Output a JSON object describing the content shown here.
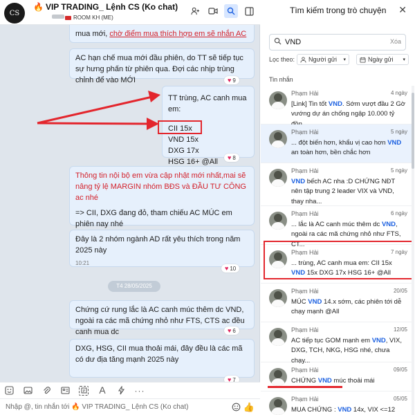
{
  "chat": {
    "avatar_text": "CS",
    "title": "VIP TRADING_ Lệnh CS (Ko chat)",
    "title_icon": "fire-icon",
    "subtitle": "ROOM KH (ME)",
    "header_icons": [
      "add-member-icon",
      "video-call-icon",
      "search-icon",
      "layout-toggle-icon"
    ]
  },
  "messages": {
    "m0_part1": "mua mới, ",
    "m0_part2": "chờ điểm mua thích hợp em sẽ nhắn AC",
    "m1": "AC hạn chế mua mới đầu phiên, do TT sẽ tiếp tục sự hưng phấn từ phiên qua. Đợi các nhịp trùng chỉnh để vào MỚI",
    "m1_react": "9",
    "m2_lines": [
      "TT trùng, AC canh mua em:",
      "CII 15x",
      "VND 15x",
      "DXG 17x",
      "HSG 16+ @All"
    ],
    "m2_react": "8",
    "m3_red": "Thông tin nội bộ em vừa cập nhật mới nhất,mai sẽ nâng tỷ lệ MARGIN nhóm BĐS và ĐẦU TƯ CÔNG ac nhé",
    "m3_black": "=> CII, DXG đang đỏ, tham chiếu AC  MÚC em phiên nay nhé",
    "m4": "Đây là 2 nhóm ngành AD rất yêu thích trong năm 2025 này",
    "m4_time": "10:21",
    "m4_react": "10",
    "date_sep": "T4 28/05/2025",
    "m5": "Chứng cứ rung lắc là AC canh múc thêm dc VND, ngoài ra các mã chứng nhỏ như FTS, CTS ac đều canh mua dc",
    "m5_react": "6",
    "m6": "DXG, HSG, CII mua thoải mái, đây đều là các mã có dư địa tăng mạnh 2025 này",
    "m6_react": "7"
  },
  "composer": {
    "placeholder": "Nhập @, tin nhắn tới 🔥 VIP TRADING_ Lệnh CS (Ko chat)",
    "toolbar_icons": [
      "sticker-icon",
      "image-icon",
      "attachment-icon",
      "contact-card-icon",
      "screenshot-icon",
      "text-format-icon",
      "quick-message-icon",
      "more-icon"
    ]
  },
  "search": {
    "title": "Tìm kiếm trong trò chuyện",
    "query": "VND",
    "clear_label": "Xóa",
    "filter_label": "Lọc theo:",
    "filter_sender": "Người gửi",
    "filter_date": "Ngày gửi",
    "section_label": "Tin nhắn",
    "results": [
      {
        "sender": "Phạm Hải",
        "date": "4 ngày",
        "pre": "[Link] Tin tốt ",
        "kw": "VND",
        "post": ". Sớm vượt đầu 2 Gờ vướng dự án chống ngập 10.000 tỷ đồn..."
      },
      {
        "sender": "Phạm Hải",
        "date": "5 ngày",
        "pre": "... đột biến hơn, khẩu vị cao hơn ",
        "kw": "VND",
        "post": " an toàn hơn, bền chắc hơn"
      },
      {
        "sender": "Phạm Hải",
        "date": "5 ngày",
        "pre": "",
        "kw": "VND",
        "post": " bếch AC nha :D CHỨNG NĐT nên tập trung 2 leader VIX và VND, thay nha..."
      },
      {
        "sender": "Phạm Hải",
        "date": "6 ngày",
        "pre": "... lắc là AC canh múc thêm dc ",
        "kw": "VND",
        "post": ", ngoài ra các mã chứng nhỏ như FTS, CT..."
      },
      {
        "sender": "Phạm Hải",
        "date": "7 ngày",
        "pre": "... trùng, AC canh mua em: CII 15x ",
        "kw": "VND",
        "post": " 15x DXG 17x HSG 16+ @All"
      },
      {
        "sender": "Phạm Hải",
        "date": "20/05",
        "pre": "MÚC ",
        "kw": "VND",
        "post": " 14.x sớm, các phiên tới dễ chạy mạnh @All"
      },
      {
        "sender": "Phạm Hải",
        "date": "12/05",
        "pre": "AC tiếp tục GOM mạnh em ",
        "kw": "VND",
        "post": ", VIX, DXG, TCH, NKG, HSG nhé, chưa chạy..."
      },
      {
        "sender": "Phạm Hải",
        "date": "09/05",
        "pre": "CHỨNG ",
        "kw": "VND",
        "post": " múc thoải mái"
      },
      {
        "sender": "Phạm Hải",
        "date": "05/05",
        "pre": "MUA CHỨNG : ",
        "kw": "VND",
        "post": " 14x, VIX <=12"
      }
    ]
  }
}
